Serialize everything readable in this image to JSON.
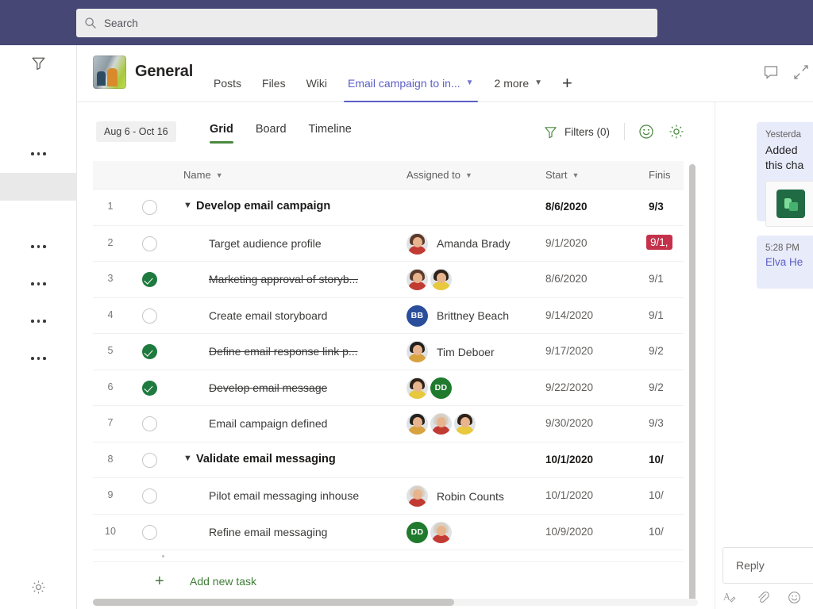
{
  "search": {
    "placeholder": "Search",
    "icon": "search-icon"
  },
  "rail": {
    "filter_icon": "filter-icon",
    "settings_icon": "gear-icon",
    "overflow_label": "..."
  },
  "channel": {
    "team_name": "General",
    "tabs": [
      {
        "label": "Posts",
        "active": false,
        "has_chevron": false
      },
      {
        "label": "Files",
        "active": false,
        "has_chevron": false
      },
      {
        "label": "Wiki",
        "active": false,
        "has_chevron": false
      },
      {
        "label": "Email campaign to in...",
        "active": true,
        "has_chevron": true
      },
      {
        "label": "2 more",
        "active": false,
        "has_chevron": true
      }
    ],
    "add_tab_label": "+",
    "chat_icon": "chat-bubble-icon",
    "expand_icon": "expand-collapse-icon"
  },
  "planner": {
    "date_range": "Aug 6 - Oct 16",
    "views": [
      {
        "label": "Grid",
        "active": true
      },
      {
        "label": "Board",
        "active": false
      },
      {
        "label": "Timeline",
        "active": false
      }
    ],
    "filters_label": "Filters (0)",
    "filters_icon": "funnel-icon",
    "smiley_icon": "smiley-icon",
    "settings_icon": "gear-icon",
    "columns": [
      {
        "label": "Name"
      },
      {
        "label": "Assigned to"
      },
      {
        "label": "Start"
      },
      {
        "label": "Finis"
      }
    ],
    "add_new_task": "Add new task",
    "tasks": [
      {
        "num": "1",
        "name": "Develop email campaign",
        "group": true,
        "done": false,
        "strike": false,
        "assignees": [],
        "start": "8/6/2020",
        "finish": "9/3",
        "late": false
      },
      {
        "num": "2",
        "name": "Target audience profile",
        "group": false,
        "done": false,
        "strike": false,
        "assignees": [
          {
            "type": "photo",
            "name": "Amanda Brady",
            "hair": "#5b3a2b",
            "body": "#c23b33"
          }
        ],
        "assignee_label": "Amanda Brady",
        "start": "9/1/2020",
        "finish": "9/1,",
        "late": true
      },
      {
        "num": "3",
        "name": "Marketing approval of storyb...",
        "group": false,
        "done": true,
        "strike": true,
        "assignees": [
          {
            "type": "photo",
            "name": "Amanda Brady",
            "hair": "#5b3a2b",
            "body": "#c23b33"
          },
          {
            "type": "photo",
            "name": "Yellow person",
            "hair": "#2e2118",
            "body": "#e8c83c"
          }
        ],
        "assignee_label": "",
        "start": "8/6/2020",
        "finish": "9/1",
        "late": false
      },
      {
        "num": "4",
        "name": "Create email storyboard",
        "group": false,
        "done": false,
        "strike": false,
        "assignees": [
          {
            "type": "initials",
            "initials": "BB",
            "color": "#2a4e9b",
            "name": "Brittney Beach"
          }
        ],
        "assignee_label": "Brittney Beach",
        "start": "9/14/2020",
        "finish": "9/1",
        "late": false
      },
      {
        "num": "5",
        "name": "Define email response link p...",
        "group": false,
        "done": true,
        "strike": true,
        "assignees": [
          {
            "type": "photo",
            "name": "Tim Deboer",
            "hair": "#23201d",
            "body": "#d8a23f"
          }
        ],
        "assignee_label": "Tim Deboer",
        "start": "9/17/2020",
        "finish": "9/2",
        "late": false
      },
      {
        "num": "6",
        "name": "Develop email message",
        "group": false,
        "done": true,
        "strike": true,
        "assignees": [
          {
            "type": "photo",
            "name": "Yellow person",
            "hair": "#2e2118",
            "body": "#e8c83c"
          },
          {
            "type": "initials",
            "initials": "DD",
            "color": "#1f7a2e",
            "name": "DD"
          }
        ],
        "assignee_label": "",
        "start": "9/22/2020",
        "finish": "9/2",
        "late": false
      },
      {
        "num": "7",
        "name": "Email campaign defined",
        "group": false,
        "done": false,
        "strike": false,
        "assignees": [
          {
            "type": "photo",
            "name": "Tim Deboer",
            "hair": "#23201d",
            "body": "#d8a23f"
          },
          {
            "type": "photo",
            "name": "Robin Counts",
            "hair": "#d8cfc2",
            "body": "#c23b33"
          },
          {
            "type": "photo",
            "name": "Yellow person",
            "hair": "#2e2118",
            "body": "#e8c83c"
          }
        ],
        "assignee_label": "",
        "start": "9/30/2020",
        "finish": "9/3",
        "late": false
      },
      {
        "num": "8",
        "name": "Validate email messaging",
        "group": true,
        "done": false,
        "strike": false,
        "assignees": [],
        "start": "10/1/2020",
        "finish": "10/",
        "late": false
      },
      {
        "num": "9",
        "name": "Pilot email messaging inhouse",
        "group": false,
        "done": false,
        "strike": false,
        "assignees": [
          {
            "type": "photo",
            "name": "Robin Counts",
            "hair": "#d8cfc2",
            "body": "#c23b33"
          }
        ],
        "assignee_label": "Robin Counts",
        "start": "10/1/2020",
        "finish": "10/",
        "late": false
      },
      {
        "num": "10",
        "name": "Refine email messaging",
        "group": false,
        "done": false,
        "strike": false,
        "assignees": [
          {
            "type": "initials",
            "initials": "DD",
            "color": "#1f7a2e",
            "name": "DD"
          },
          {
            "type": "photo",
            "name": "Robin Counts",
            "hair": "#d8cfc2",
            "body": "#c23b33"
          }
        ],
        "assignee_label": "",
        "start": "10/9/2020",
        "finish": "10/",
        "late": false
      }
    ]
  },
  "chat_panel": {
    "messages": [
      {
        "time": "Yesterda",
        "lines": [
          "Added",
          "this cha"
        ],
        "has_card": true,
        "card_icon": "planner-app-icon"
      },
      {
        "time": "5:28 PM",
        "author": "Elva He"
      }
    ],
    "reply_placeholder": "Reply",
    "reply_icons": [
      "format-icon",
      "attach-icon",
      "emoji-icon",
      "giphy-icon"
    ]
  },
  "colors": {
    "brand_purple": "#464775",
    "accent_purple": "#5b5fc7",
    "planner_green": "#4a8a3f",
    "done_green": "#1f7a3f",
    "late_red": "#c4314b"
  }
}
